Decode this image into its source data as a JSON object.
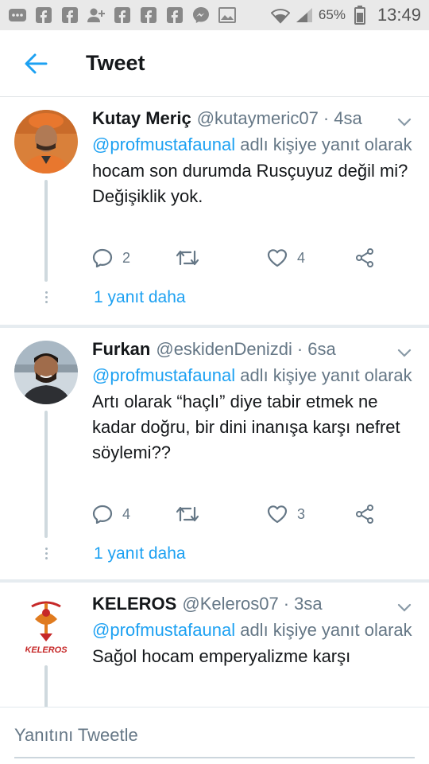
{
  "status_bar": {
    "battery_pct": "65%",
    "time": "13:49",
    "icons": [
      "messages-icon",
      "facebook-icon",
      "facebook-icon",
      "add-friend-icon",
      "facebook-icon",
      "facebook-icon",
      "facebook-icon",
      "messenger-icon",
      "gallery-icon",
      "wifi-icon",
      "signal-icon",
      "battery-icon"
    ]
  },
  "header": {
    "title": "Tweet",
    "back_icon": "arrow-left-icon"
  },
  "colors": {
    "accent": "#1da1f2",
    "secondary_text": "#657786",
    "primary_text": "#14171a"
  },
  "tweets": [
    {
      "name": "Kutay Meriç",
      "handle": "@kutaymeric07",
      "sep": "·",
      "time": "4sa",
      "reply_mention": "@profmustafaunal",
      "reply_suffix": " adlı kişiye yanıt olarak",
      "text": "hocam son durumda Rusçuyuz değil mi? Değişiklik yok.",
      "replies": "2",
      "retweets": "",
      "likes": "4",
      "more_replies": "1 yanıt daha"
    },
    {
      "name": "Furkan",
      "handle": "@eskidenDenizdi",
      "sep": "·",
      "time": "6sa",
      "reply_mention": "@profmustafaunal",
      "reply_suffix": " adlı kişiye yanıt olarak",
      "text": "Artı olarak “haçlı” diye tabir etmek ne kadar doğru, bir dini inanışa karşı nefret söylemi??",
      "replies": "4",
      "retweets": "",
      "likes": "3",
      "more_replies": "1 yanıt daha"
    },
    {
      "name": "KELEROS",
      "handle": "@Keleros07",
      "sep": "·",
      "time": "3sa",
      "reply_mention": "@profmustafaunal",
      "reply_suffix": " adlı kişiye yanıt olarak",
      "text": "Sağol hocam emperyalizme karşı",
      "avatar_logo_text": "KELEROS"
    }
  ],
  "reply_box": {
    "placeholder": "Yanıtını Tweetle"
  }
}
